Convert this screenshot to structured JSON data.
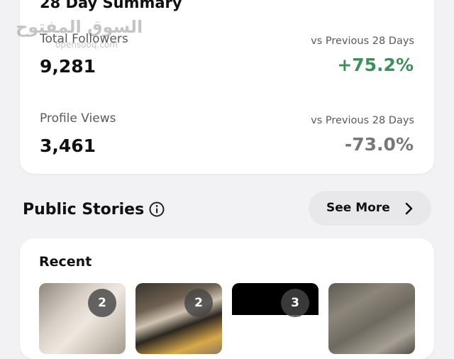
{
  "summary": {
    "title": "28 Day Summary",
    "watermark_ar": "السوق المفتوح",
    "watermark_en": "opensooq.com",
    "metrics": [
      {
        "label": "Total Followers",
        "value": "9,281",
        "compare_label": "vs Previous 28 Days",
        "change": "+75.2%",
        "change_color": "#3f8f5d"
      },
      {
        "label": "Profile Views",
        "value": "3,461",
        "compare_label": "vs Previous 28 Days",
        "change": "-73.0%",
        "change_color": "#77777b"
      }
    ]
  },
  "public_stories": {
    "title": "Public Stories",
    "info_icon": "info-icon",
    "see_more_label": "See More",
    "chevron_icon": "chevron-right-icon"
  },
  "recent": {
    "title": "Recent",
    "stories": [
      {
        "count": "2"
      },
      {
        "count": "2"
      },
      {
        "count": "3"
      },
      {
        "count": ""
      }
    ]
  }
}
